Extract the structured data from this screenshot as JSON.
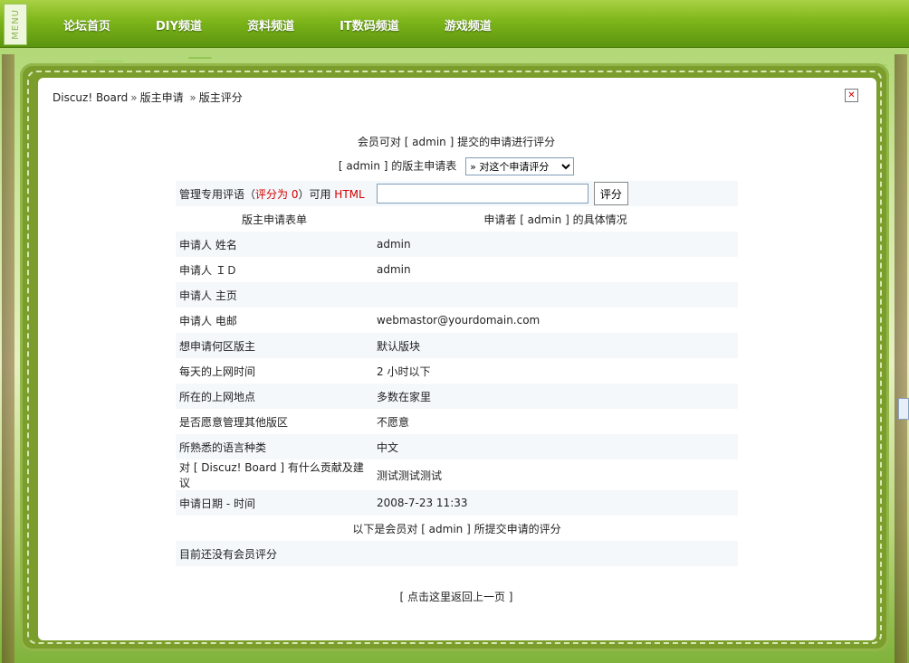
{
  "top_menu": {
    "menu_tab": "MENU",
    "items": [
      "论坛首页",
      "DIY频道",
      "资料频道",
      "IT数码频道",
      "游戏频道"
    ]
  },
  "breadcrumb": {
    "items": [
      "Discuz! Board",
      "版主申请",
      "版主评分"
    ],
    "separator": "»"
  },
  "close_icon": "close-icon",
  "intro_line": "会员可对 [ admin ] 提交的申请进行评分",
  "form_line": {
    "label": "[ admin ] 的版主申请表",
    "select_value": "» 对这个申请评分"
  },
  "comment_row": {
    "label_prefix": "管理专用评语（",
    "label_score": "评分为 0",
    "label_suffix": "）可用 ",
    "label_html": "HTML",
    "input_value": "",
    "button": "评分"
  },
  "table_header": {
    "left": "版主申请表单",
    "right": "申请者 [ admin ] 的具体情况"
  },
  "rows": [
    {
      "key": "申请人 姓名",
      "value": "admin"
    },
    {
      "key": "申请人 ＩＤ",
      "value": "admin"
    },
    {
      "key": "申请人 主页",
      "value": ""
    },
    {
      "key": "申请人 电邮",
      "value": "webmastor@yourdomain.com"
    },
    {
      "key": "想申请何区版主",
      "value": "默认版块"
    },
    {
      "key": "每天的上网时间",
      "value": "2 小时以下"
    },
    {
      "key": "所在的上网地点",
      "value": "多数在家里"
    },
    {
      "key": "是否愿意管理其他版区",
      "value": "不愿意"
    },
    {
      "key": "所熟悉的语言种类",
      "value": "中文"
    },
    {
      "key": "对 [ Discuz! Board ] 有什么贡献及建议",
      "value": "测试测试测试"
    },
    {
      "key": "申请日期 - 时间",
      "value": "2008-7-23 11:33"
    }
  ],
  "ratings_header": "以下是会员对 [ admin ] 所提交申请的评分",
  "ratings_empty": "目前还没有会员评分",
  "back_link": "[ 点击这里返回上一页 ]"
}
